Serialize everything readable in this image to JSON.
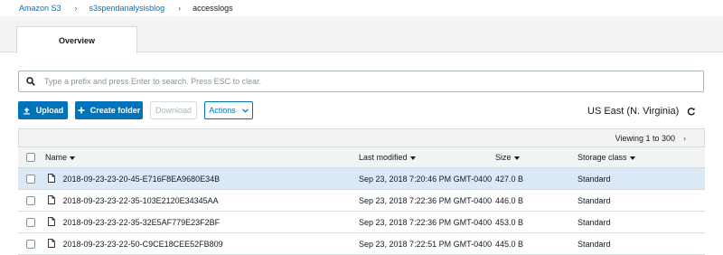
{
  "breadcrumb": {
    "items": [
      "Amazon S3",
      "s3spendanalysisblog"
    ],
    "current": "accesslogs"
  },
  "tabs": [
    {
      "label": "Overview",
      "active": true
    }
  ],
  "search": {
    "placeholder": "Type a prefix and press Enter to search. Press ESC to clear.",
    "value": ""
  },
  "toolbar": {
    "upload_label": "Upload",
    "create_folder_label": "Create folder",
    "download_label": "Download",
    "actions_label": "Actions"
  },
  "region": "US East (N. Virginia)",
  "viewing": "Viewing 1 to 300",
  "columns": [
    "Name",
    "Last modified",
    "Size",
    "Storage class"
  ],
  "rows": [
    {
      "name": "2018-09-23-23-20-45-E716F8EA9680E34B",
      "modified": "Sep 23, 2018 7:20:46 PM GMT-0400",
      "size": "427.0 B",
      "storage_class": "Standard",
      "selected": true
    },
    {
      "name": "2018-09-23-23-22-35-103E2120E34345AA",
      "modified": "Sep 23, 2018 7:22:36 PM GMT-0400",
      "size": "446.0 B",
      "storage_class": "Standard",
      "selected": false
    },
    {
      "name": "2018-09-23-23-22-35-32E5AF779E23F2BF",
      "modified": "Sep 23, 2018 7:22:36 PM GMT-0400",
      "size": "453.0 B",
      "storage_class": "Standard",
      "selected": false
    },
    {
      "name": "2018-09-23-23-22-50-C9CE18CEE52FB809",
      "modified": "Sep 23, 2018 7:22:51 PM GMT-0400",
      "size": "445.0 B",
      "storage_class": "Standard",
      "selected": false
    }
  ],
  "colors": {
    "link": "#0073bb",
    "primary_button": "#0073bb",
    "selected_row": "#dae9f5",
    "header_bg": "#f2f3f3"
  },
  "icons": {
    "search": "search-icon",
    "upload": "upload-icon",
    "create_folder": "plus-icon",
    "refresh": "refresh-icon",
    "file": "file-icon"
  }
}
